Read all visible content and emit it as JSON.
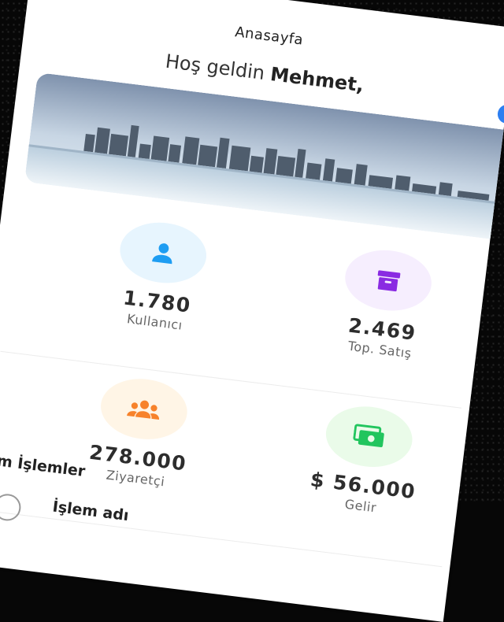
{
  "header": {
    "title": "Anasayfa"
  },
  "greeting": {
    "prefix": "Hoş geldin",
    "name": "Mehmet,"
  },
  "banner": {
    "image": "city-skyline-waterfront"
  },
  "stats": [
    {
      "icon": "user-icon",
      "value": "1.780",
      "label": "Kullanıcı",
      "color": "#1e9df2",
      "bg": "#e7f5fe"
    },
    {
      "icon": "box-icon",
      "value": "2.469",
      "label": "Top. Satış",
      "color": "#8a2be2",
      "bg": "#f6eefe"
    },
    {
      "icon": "group-icon",
      "value": "278.000",
      "label": "Ziyaretçi",
      "color": "#f7822b",
      "bg": "#fff5e6"
    },
    {
      "icon": "money-icon",
      "value": "$ 56.000",
      "label": "Gelir",
      "color": "#22c55e",
      "bg": "#eafbe9"
    }
  ],
  "transactions": {
    "title": "Tüm İşlemler",
    "first_row_name": "İşlem adı"
  }
}
